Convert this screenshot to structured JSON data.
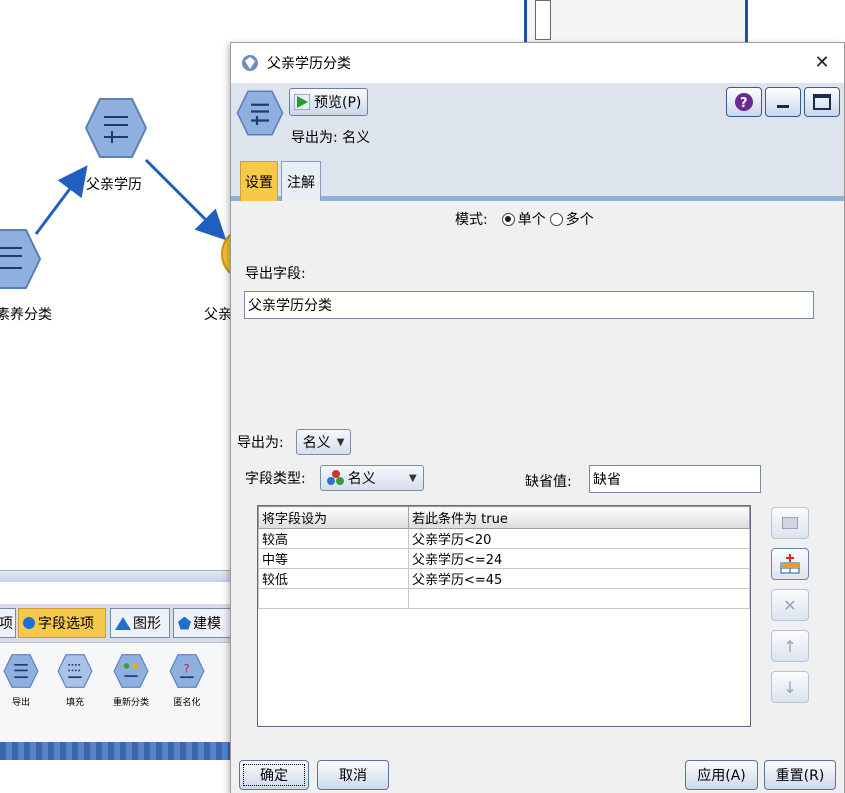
{
  "canvas": {
    "nodes": [
      {
        "label": "父亲学历"
      },
      {
        "label": "素养分类"
      },
      {
        "label": "父亲"
      }
    ]
  },
  "palette": {
    "tabs": [
      "项",
      "字段选项",
      "图形",
      "建模"
    ],
    "active_tab": "字段选项",
    "items": [
      "导出",
      "填充",
      "重新分类",
      "匿名化"
    ]
  },
  "dialog": {
    "title": "父亲学历分类",
    "preview_label": "预览(P)",
    "export_as_header": "导出为: 名义",
    "tabs": [
      "设置",
      "注解"
    ],
    "active_tab": "设置",
    "mode_label": "模式:",
    "mode_options": [
      "单个",
      "多个"
    ],
    "mode_selected": "单个",
    "derive_field_label": "导出字段:",
    "derive_field_value": "父亲学历分类",
    "derive_as_label": "导出为:",
    "derive_as_value": "名义",
    "field_type_label": "字段类型:",
    "field_type_value": "名义",
    "missing_label": "缺省值:",
    "missing_value": "缺省",
    "table": {
      "headers": [
        "将字段设为",
        "若此条件为 true"
      ],
      "rows": [
        [
          "较高",
          "父亲学历<20"
        ],
        [
          "中等",
          "父亲学历<=24"
        ],
        [
          "较低",
          "父亲学历<=45"
        ],
        [
          "",
          ""
        ]
      ]
    },
    "buttons": {
      "ok": "确定",
      "cancel": "取消",
      "apply": "应用(A)",
      "reset": "重置(R)"
    }
  },
  "colors": {
    "node_blue": "#7ea3d4",
    "tab_active": "#f7c94b",
    "link_blue": "#1f5fbf"
  }
}
